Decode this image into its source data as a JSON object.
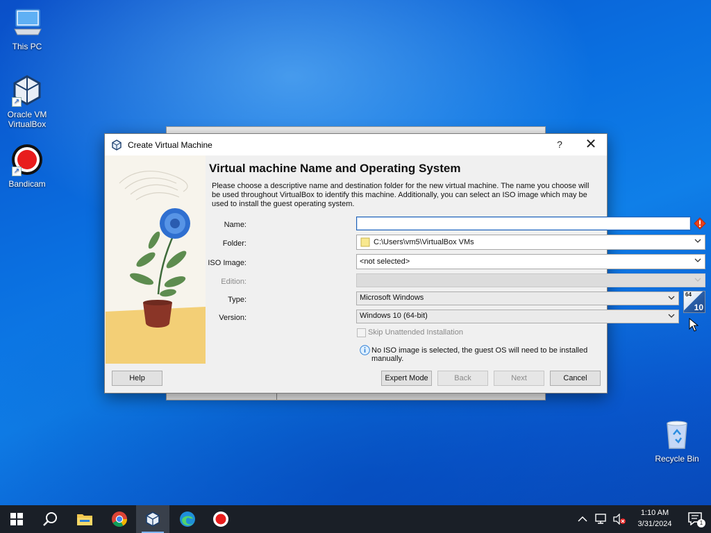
{
  "desktop": {
    "icons": [
      {
        "label": "This PC"
      },
      {
        "label": "Oracle VM VirtualBox"
      },
      {
        "label": "Bandicam"
      },
      {
        "label": "Recycle Bin"
      }
    ]
  },
  "dialog": {
    "title": "Create Virtual Machine",
    "help_glyph": "?",
    "close_glyph": "✕",
    "heading": "Virtual machine Name and Operating System",
    "description": "Please choose a descriptive name and destination folder for the new virtual machine. The name you choose will be used throughout VirtualBox to identify this machine. Additionally, you can select an ISO image which may be used to install the guest operating system.",
    "fields": {
      "name": {
        "label": "Name:",
        "value": ""
      },
      "folder": {
        "label": "Folder:",
        "value": "C:\\Users\\vm5\\VirtualBox VMs"
      },
      "iso": {
        "label": "ISO Image:",
        "value": "<not selected>"
      },
      "edition": {
        "label": "Edition:",
        "value": ""
      },
      "type": {
        "label": "Type:",
        "value": "Microsoft Windows"
      },
      "version": {
        "label": "Version:",
        "value": "Windows 10 (64-bit)"
      }
    },
    "os_badge": {
      "bits": "64",
      "version": "10"
    },
    "skip_unattended": {
      "label": "Skip Unattended Installation",
      "checked": false
    },
    "info_message": "No ISO image is selected, the guest OS will need to be installed manually.",
    "buttons": {
      "help": "Help",
      "expert": "Expert Mode",
      "back": "Back",
      "next": "Next",
      "cancel": "Cancel"
    }
  },
  "taskbar": {
    "apps": [
      "start-icon",
      "search-icon",
      "file-explorer-icon",
      "chrome-icon",
      "virtualbox-icon",
      "edge-icon",
      "bandicam-icon"
    ],
    "clock": {
      "time": "1:10 AM",
      "date": "3/31/2024"
    },
    "notification_count": "1"
  },
  "colors": {
    "accent": "#1e5fb4",
    "error": "#e8411b",
    "taskbar": "#1a1f27"
  }
}
